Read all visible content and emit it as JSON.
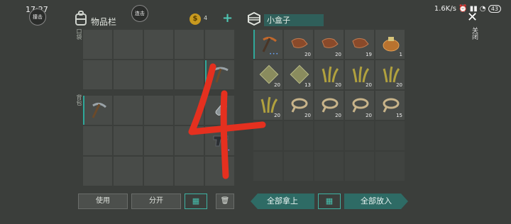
{
  "status": {
    "time": "17:27",
    "speed": "1.6K/s",
    "battery": "43"
  },
  "float_buttons": {
    "left_label": "撞击",
    "right_label": "连击"
  },
  "inventory": {
    "title": "物品栏",
    "pocket_label": "口袋",
    "backpack_label": "背包"
  },
  "currency": {
    "count": "4"
  },
  "storage": {
    "title": "小盒子"
  },
  "close_label": "关闭",
  "annotation": "4",
  "storage_items": [
    {
      "name": "pickaxe-icon",
      "qty": "",
      "dots": true
    },
    {
      "name": "leather-icon",
      "qty": "20"
    },
    {
      "name": "leather-icon",
      "qty": "20"
    },
    {
      "name": "leather-icon",
      "qty": "19"
    },
    {
      "name": "bag-icon",
      "qty": "1"
    },
    {
      "name": "fabric-icon",
      "qty": "20"
    },
    {
      "name": "fabric-icon",
      "qty": "13"
    },
    {
      "name": "grass-icon",
      "qty": "20"
    },
    {
      "name": "grass-icon",
      "qty": "20"
    },
    {
      "name": "grass-icon",
      "qty": "20"
    },
    {
      "name": "grass-icon",
      "qty": "20"
    },
    {
      "name": "rope-icon",
      "qty": "20"
    },
    {
      "name": "rope-icon",
      "qty": "20"
    },
    {
      "name": "rope-icon",
      "qty": "20"
    },
    {
      "name": "rope-icon",
      "qty": "15"
    }
  ],
  "buttons": {
    "use": "使用",
    "split": "分开",
    "take_all": "全部拿上",
    "put_all": "全部放入"
  }
}
